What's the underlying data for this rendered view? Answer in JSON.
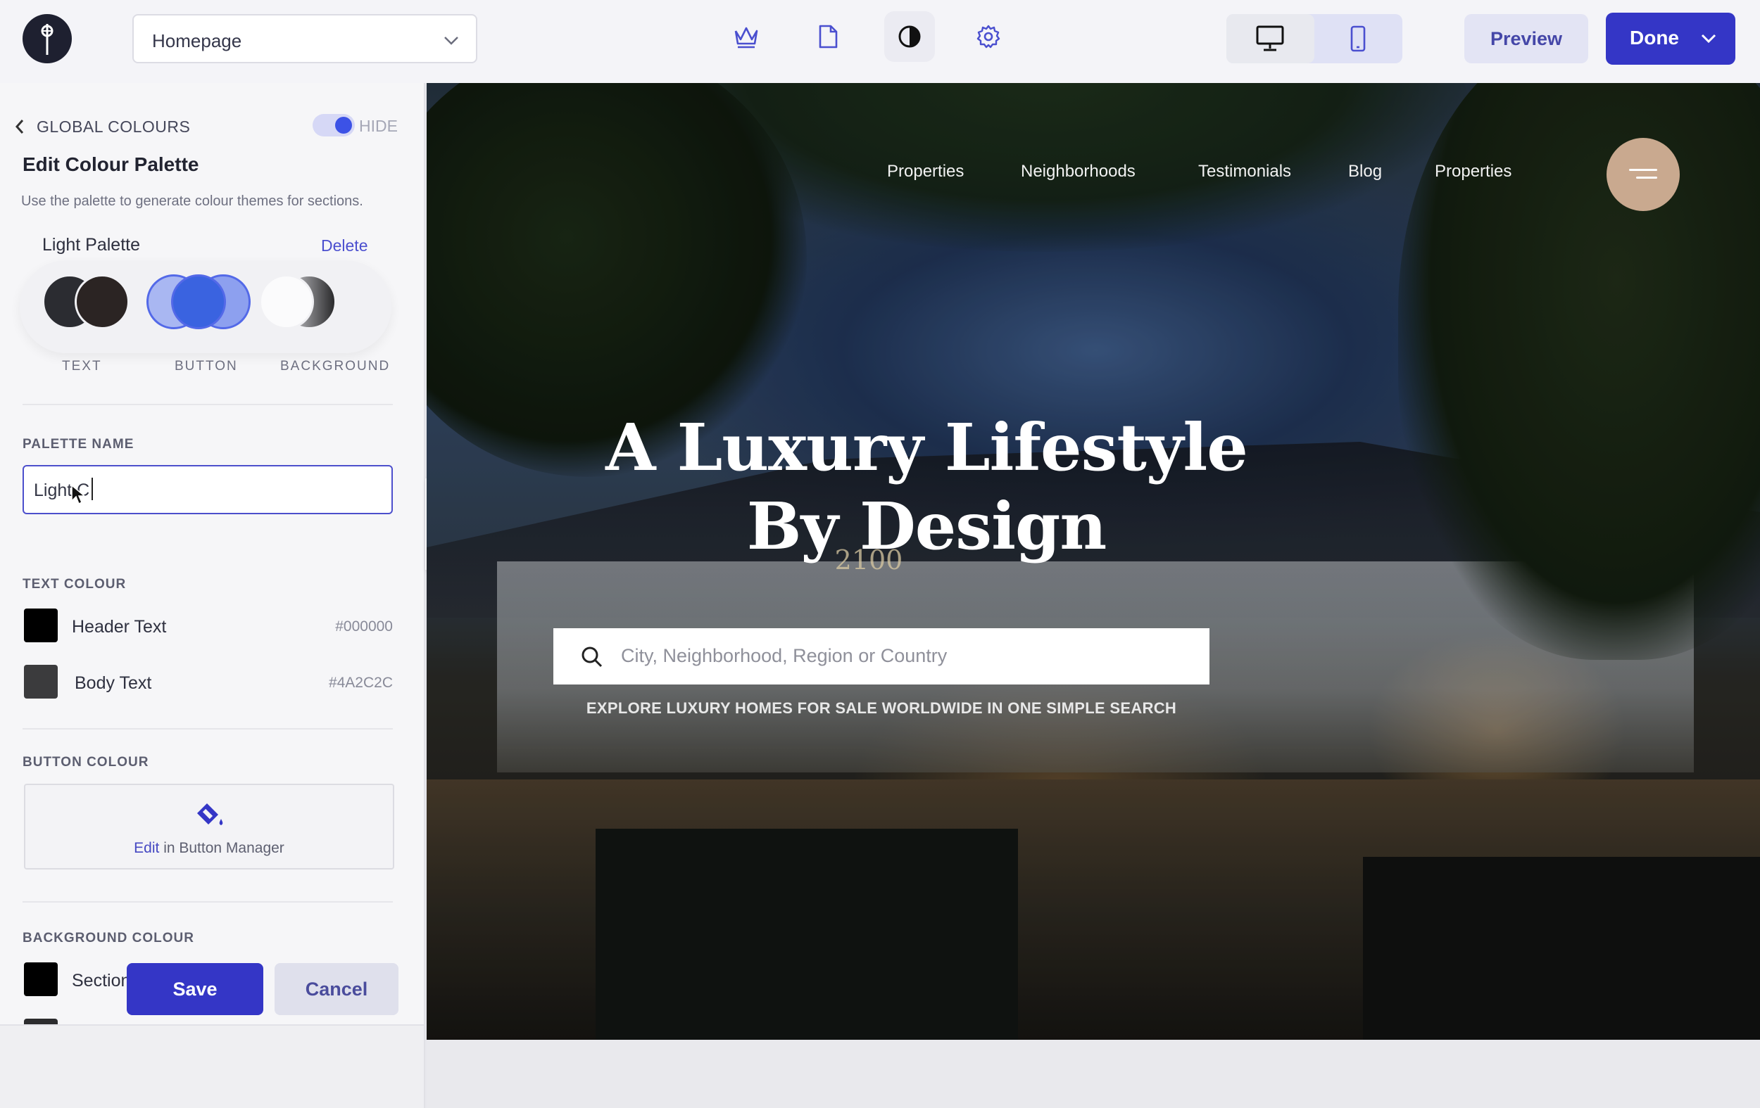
{
  "header": {
    "page_select": "Homepage",
    "preview_label": "Preview",
    "done_label": "Done",
    "toolbar_icons": [
      "crown-icon",
      "page-icon",
      "contrast-icon",
      "gear-icon"
    ],
    "active_tool": "contrast-icon",
    "device_active": "desktop"
  },
  "panel": {
    "back_label": "GLOBAL COLOURS",
    "hide_label": "HIDE",
    "title": "Edit Colour Palette",
    "description": "Use the palette to generate colour themes for sections.",
    "palette_name": "Light Palette",
    "delete_label": "Delete",
    "swatch_labels": [
      "TEXT",
      "BUTTON",
      "BACKGROUND"
    ],
    "palette_name_heading": "PALETTE NAME",
    "palette_name_value": "Light C",
    "text_colour_heading": "TEXT COLOUR",
    "text_colours": [
      {
        "name": "Header Text",
        "hex": "#000000"
      },
      {
        "name": "Body Text",
        "hex": "#4A2C2C"
      }
    ],
    "button_colour_heading": "BUTTON COLOUR",
    "button_manager_link": "Edit",
    "button_manager_rest": " in Button Manager",
    "background_colour_heading": "BACKGROUND COLOUR",
    "background_colours": [
      {
        "name": "Section",
        "hex": "#000000"
      }
    ],
    "save_label": "Save",
    "cancel_label": "Cancel"
  },
  "preview": {
    "nav": [
      "Properties",
      "Neighborhoods",
      "Testimonials",
      "Blog",
      "Properties"
    ],
    "title_line1": "A Luxury Lifestyle",
    "title_line2": "By Design",
    "search_placeholder": "City, Neighborhood, Region or Country",
    "tagline": "EXPLORE LUXURY HOMES FOR SALE WORLDWIDE IN ONE SIMPLE SEARCH",
    "sign_text": "2100"
  },
  "colors": {
    "accent": "#3436C6",
    "toggle": "#3C52E6",
    "menu_button": "#C9A98F"
  }
}
